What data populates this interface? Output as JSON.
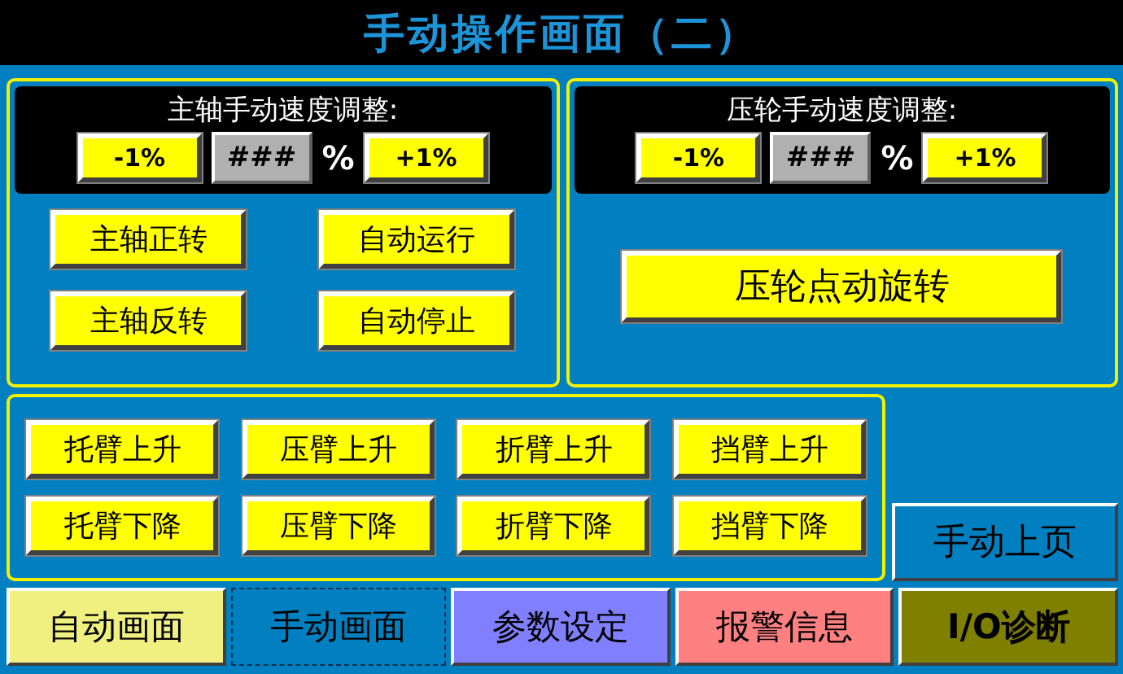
{
  "title": "手动操作画面（二）",
  "speed_panels": [
    {
      "label": "主轴手动速度调整:",
      "minus": "-1%",
      "value": "###",
      "unit": "%",
      "plus": "+1%",
      "buttons": [
        "主轴正转",
        "自动运行",
        "主轴反转",
        "自动停止"
      ]
    },
    {
      "label": "压轮手动速度调整:",
      "minus": "-1%",
      "value": "###",
      "unit": "%",
      "plus": "+1%",
      "buttons": [
        "压轮点动旋转"
      ]
    }
  ],
  "arm_buttons": [
    "托臂上升",
    "压臂上升",
    "折臂上升",
    "挡臂上升",
    "托臂下降",
    "压臂下降",
    "折臂下降",
    "挡臂下降"
  ],
  "page_button": "手动上页",
  "nav": [
    {
      "label": "自动画面",
      "selected": false,
      "color": "#f0f080"
    },
    {
      "label": "手动画面",
      "selected": true,
      "color": "#0080c0"
    },
    {
      "label": "参数设定",
      "selected": false,
      "color": "#8080ff"
    },
    {
      "label": "报警信息",
      "selected": false,
      "color": "#ff8080"
    },
    {
      "label": "I/O诊断",
      "selected": false,
      "color": "#808000"
    }
  ]
}
